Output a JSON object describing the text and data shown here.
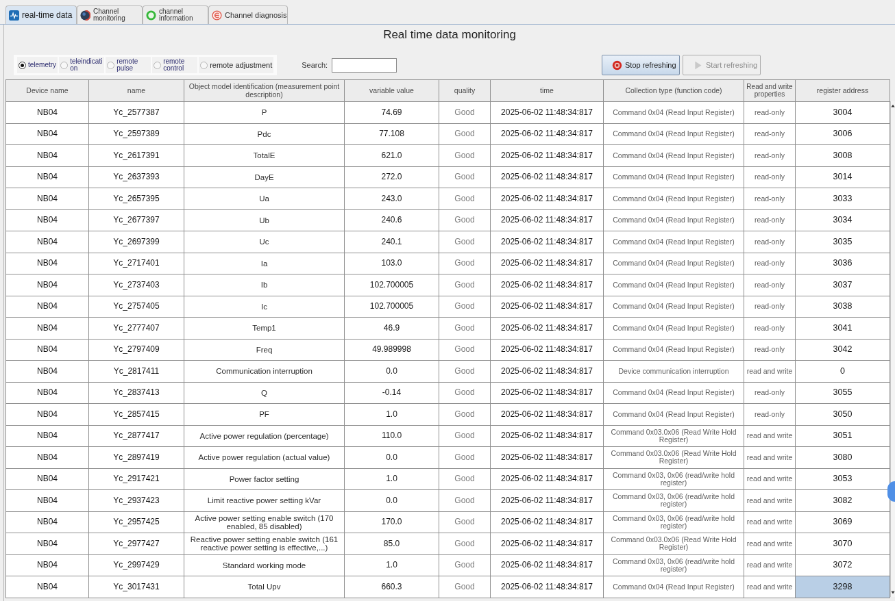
{
  "tabs": [
    {
      "label": "real-time data",
      "selected": true
    },
    {
      "label": "Channel monitoring",
      "selected": false
    },
    {
      "label": "channel information",
      "selected": false
    },
    {
      "label": "Channel diagnosis",
      "selected": false
    }
  ],
  "title": "Real time data monitoring",
  "point_types": [
    {
      "label": "telemetry",
      "selected": true
    },
    {
      "label": "teleindication",
      "selected": false
    },
    {
      "label": "remote pulse",
      "selected": false
    },
    {
      "label": "remote control",
      "selected": false
    },
    {
      "label": "remote adjustment",
      "selected": false
    }
  ],
  "search": {
    "label": "Search:"
  },
  "buttons": [
    {
      "label": "Stop refreshing",
      "disabled": false
    },
    {
      "label": "Start refreshing",
      "disabled": true
    }
  ],
  "table": {
    "columns": [
      "Device name",
      "name",
      "Object model identification (measurement point description)",
      "variable value",
      "quality",
      "time",
      "Collection type (function code)",
      "Read and write properties",
      "register address"
    ],
    "rows": [
      {
        "cells": [
          "NB04",
          "Yc_2577387",
          "P",
          "74.69",
          "Good",
          "2025-06-02 11:48:34:817",
          "Command 0x04 (Read Input Register)",
          "read-only",
          "3004"
        ],
        "selected": false
      },
      {
        "cells": [
          "NB04",
          "Yc_2597389",
          "Pdc",
          "77.108",
          "Good",
          "2025-06-02 11:48:34:817",
          "Command 0x04 (Read Input Register)",
          "read-only",
          "3006"
        ],
        "selected": false
      },
      {
        "cells": [
          "NB04",
          "Yc_2617391",
          "TotalE",
          "621.0",
          "Good",
          "2025-06-02 11:48:34:817",
          "Command 0x04 (Read Input Register)",
          "read-only",
          "3008"
        ],
        "selected": false
      },
      {
        "cells": [
          "NB04",
          "Yc_2637393",
          "DayE",
          "272.0",
          "Good",
          "2025-06-02 11:48:34:817",
          "Command 0x04 (Read Input Register)",
          "read-only",
          "3014"
        ],
        "selected": false
      },
      {
        "cells": [
          "NB04",
          "Yc_2657395",
          "Ua",
          "243.0",
          "Good",
          "2025-06-02 11:48:34:817",
          "Command 0x04 (Read Input Register)",
          "read-only",
          "3033"
        ],
        "selected": false
      },
      {
        "cells": [
          "NB04",
          "Yc_2677397",
          "Ub",
          "240.6",
          "Good",
          "2025-06-02 11:48:34:817",
          "Command 0x04 (Read Input Register)",
          "read-only",
          "3034"
        ],
        "selected": false
      },
      {
        "cells": [
          "NB04",
          "Yc_2697399",
          "Uc",
          "240.1",
          "Good",
          "2025-06-02 11:48:34:817",
          "Command 0x04 (Read Input Register)",
          "read-only",
          "3035"
        ],
        "selected": false
      },
      {
        "cells": [
          "NB04",
          "Yc_2717401",
          "Ia",
          "103.0",
          "Good",
          "2025-06-02 11:48:34:817",
          "Command 0x04 (Read Input Register)",
          "read-only",
          "3036"
        ],
        "selected": false
      },
      {
        "cells": [
          "NB04",
          "Yc_2737403",
          "Ib",
          "102.700005",
          "Good",
          "2025-06-02 11:48:34:817",
          "Command 0x04 (Read Input Register)",
          "read-only",
          "3037"
        ],
        "selected": false
      },
      {
        "cells": [
          "NB04",
          "Yc_2757405",
          "Ic",
          "102.700005",
          "Good",
          "2025-06-02 11:48:34:817",
          "Command 0x04 (Read Input Register)",
          "read-only",
          "3038"
        ],
        "selected": false
      },
      {
        "cells": [
          "NB04",
          "Yc_2777407",
          "Temp1",
          "46.9",
          "Good",
          "2025-06-02 11:48:34:817",
          "Command 0x04 (Read Input Register)",
          "read-only",
          "3041"
        ],
        "selected": false
      },
      {
        "cells": [
          "NB04",
          "Yc_2797409",
          "Freq",
          "49.989998",
          "Good",
          "2025-06-02 11:48:34:817",
          "Command 0x04 (Read Input Register)",
          "read-only",
          "3042"
        ],
        "selected": false
      },
      {
        "cells": [
          "NB04",
          "Yc_2817411",
          "Communication interruption",
          "0.0",
          "Good",
          "2025-06-02 11:48:34:817",
          "Device communication interruption",
          "read and write",
          "0"
        ],
        "selected": false
      },
      {
        "cells": [
          "NB04",
          "Yc_2837413",
          "Q",
          "-0.14",
          "Good",
          "2025-06-02 11:48:34:817",
          "Command 0x04 (Read Input Register)",
          "read-only",
          "3055"
        ],
        "selected": false
      },
      {
        "cells": [
          "NB04",
          "Yc_2857415",
          "PF",
          "1.0",
          "Good",
          "2025-06-02 11:48:34:817",
          "Command 0x04 (Read Input Register)",
          "read-only",
          "3050"
        ],
        "selected": false
      },
      {
        "cells": [
          "NB04",
          "Yc_2877417",
          "Active power regulation (percentage)",
          "110.0",
          "Good",
          "2025-06-02 11:48:34:817",
          "Command 0x03.0x06 (Read Write Hold Register)",
          "read and write",
          "3051"
        ],
        "selected": false
      },
      {
        "cells": [
          "NB04",
          "Yc_2897419",
          "Active power regulation (actual value)",
          "0.0",
          "Good",
          "2025-06-02 11:48:34:817",
          "Command 0x03.0x06 (Read Write Hold Register)",
          "read and write",
          "3080"
        ],
        "selected": false
      },
      {
        "cells": [
          "NB04",
          "Yc_2917421",
          "Power factor setting",
          "1.0",
          "Good",
          "2025-06-02 11:48:34:817",
          "Command 0x03, 0x06 (read/write hold register)",
          "read and write",
          "3053"
        ],
        "selected": false
      },
      {
        "cells": [
          "NB04",
          "Yc_2937423",
          "Limit reactive power setting kVar",
          "0.0",
          "Good",
          "2025-06-02 11:48:34:817",
          "Command 0x03, 0x06 (read/write hold register)",
          "read and write",
          "3082"
        ],
        "selected": false
      },
      {
        "cells": [
          "NB04",
          "Yc_2957425",
          "Active power setting enable switch (170 enabled, 85 disabled)",
          "170.0",
          "Good",
          "2025-06-02 11:48:34:817",
          "Command 0x03, 0x06 (read/write hold register)",
          "read and write",
          "3069"
        ],
        "selected": false
      },
      {
        "cells": [
          "NB04",
          "Yc_2977427",
          "Reactive power setting enable switch (161 reactive power setting is effective,...)",
          "85.0",
          "Good",
          "2025-06-02 11:48:34:817",
          "Command 0x03.0x06 (Read Write Hold Register)",
          "read and write",
          "3070"
        ],
        "selected": false
      },
      {
        "cells": [
          "NB04",
          "Yc_2997429",
          "Standard working mode",
          "1.0",
          "Good",
          "2025-06-02 11:48:34:817",
          "Command 0x03, 0x06 (read/write hold register)",
          "read and write",
          "3072"
        ],
        "selected": false
      },
      {
        "cells": [
          "NB04",
          "Yc_3017431",
          "Total Upv",
          "660.3",
          "Good",
          "2025-06-02 11:48:34:817",
          "Command 0x04 (Read Input Register)",
          "read and write",
          "3298"
        ],
        "selected": true
      }
    ]
  }
}
